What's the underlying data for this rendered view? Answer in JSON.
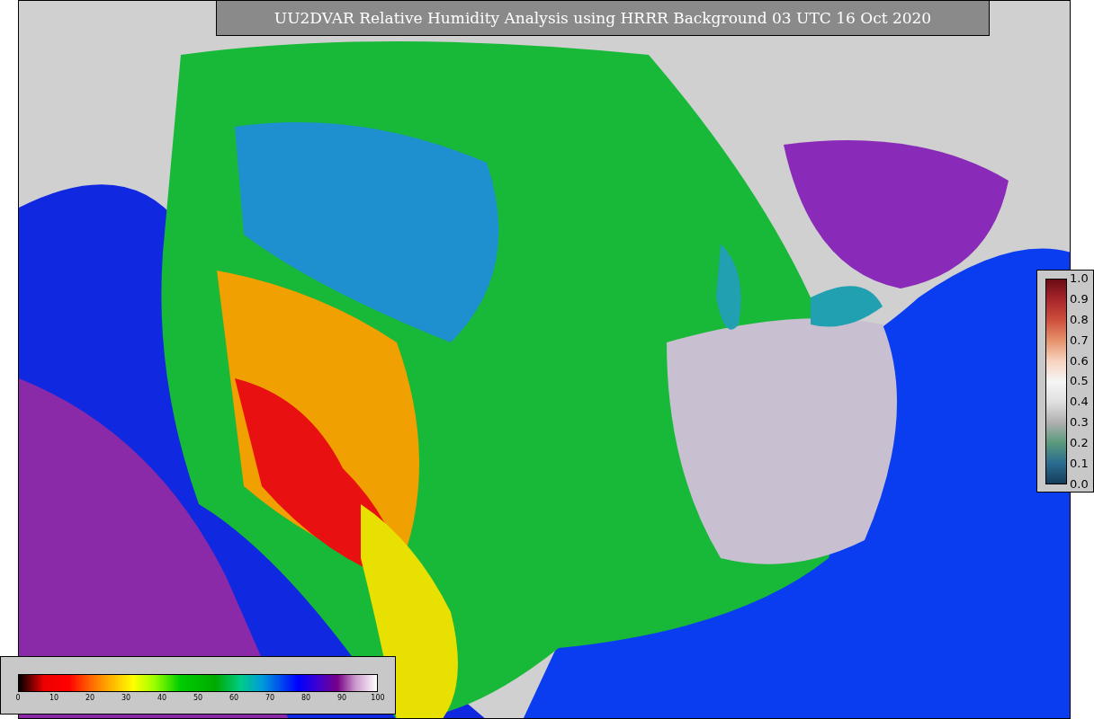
{
  "title": "UU2DVAR Relative Humidity Analysis using HRRR Background 03 UTC 16 Oct 2020",
  "humidity_scale": {
    "ticks": [
      "0",
      "10",
      "20",
      "30",
      "40",
      "50",
      "60",
      "70",
      "80",
      "90",
      "100"
    ]
  },
  "observation_scale": {
    "ticks": [
      "1.0",
      "0.9",
      "0.8",
      "0.7",
      "0.6",
      "0.5",
      "0.4",
      "0.3",
      "0.2",
      "0.1",
      "0.0"
    ]
  }
}
